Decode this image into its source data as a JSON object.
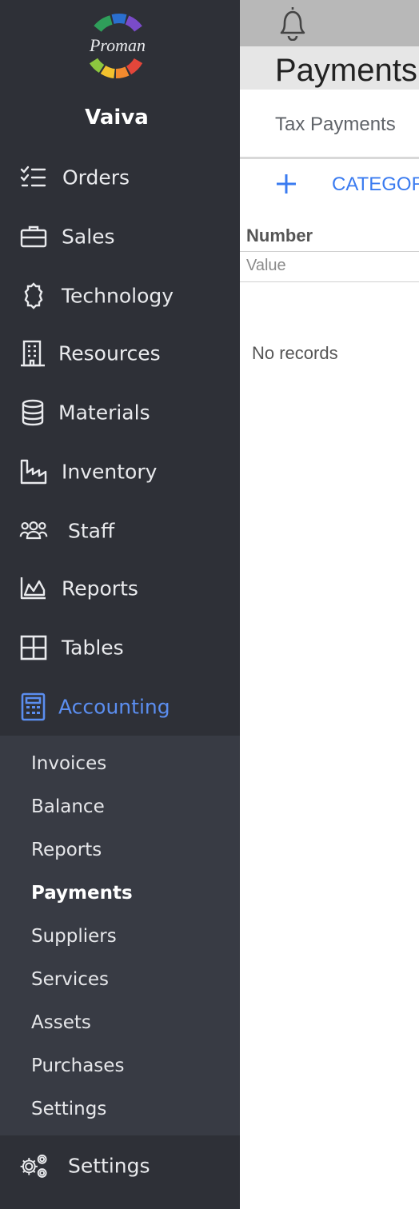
{
  "app": {
    "logo_text": "Proman",
    "user_name": "Vaiva"
  },
  "nav": [
    {
      "key": "orders",
      "label": "Orders",
      "icon": "checklist-icon"
    },
    {
      "key": "sales",
      "label": "Sales",
      "icon": "briefcase-icon"
    },
    {
      "key": "technology",
      "label": "Technology",
      "icon": "cog-icon"
    },
    {
      "key": "resources",
      "label": "Resources",
      "icon": "building-icon"
    },
    {
      "key": "materials",
      "label": "Materials",
      "icon": "database-icon"
    },
    {
      "key": "inventory",
      "label": "Inventory",
      "icon": "factory-icon"
    },
    {
      "key": "staff",
      "label": "Staff",
      "icon": "users-icon"
    },
    {
      "key": "reports",
      "label": "Reports",
      "icon": "area-chart-icon"
    },
    {
      "key": "tables",
      "label": "Tables",
      "icon": "table-icon"
    },
    {
      "key": "accounting",
      "label": "Accounting",
      "icon": "calculator-icon",
      "active": true
    }
  ],
  "accounting_submenu": [
    {
      "label": "Invoices"
    },
    {
      "label": "Balance"
    },
    {
      "label": "Reports"
    },
    {
      "label": "Payments",
      "active": true
    },
    {
      "label": "Suppliers"
    },
    {
      "label": "Services"
    },
    {
      "label": "Assets"
    },
    {
      "label": "Purchases"
    },
    {
      "label": "Settings"
    }
  ],
  "bottom_nav": {
    "label": "Settings",
    "icon": "gears-icon"
  },
  "header": {
    "page_title": "Payments"
  },
  "tabs": [
    {
      "label": "Tax Payments"
    }
  ],
  "toolbar": {
    "add_label": "+",
    "category_label": "CATEGORY"
  },
  "table": {
    "columns": [
      {
        "header": "Number",
        "filter_placeholder": "Value"
      }
    ],
    "empty_text": "No records"
  },
  "colors": {
    "sidebar_bg": "#2e3037",
    "submenu_bg": "#383b44",
    "accent": "#5b8ef0",
    "link": "#3a7bf0"
  }
}
